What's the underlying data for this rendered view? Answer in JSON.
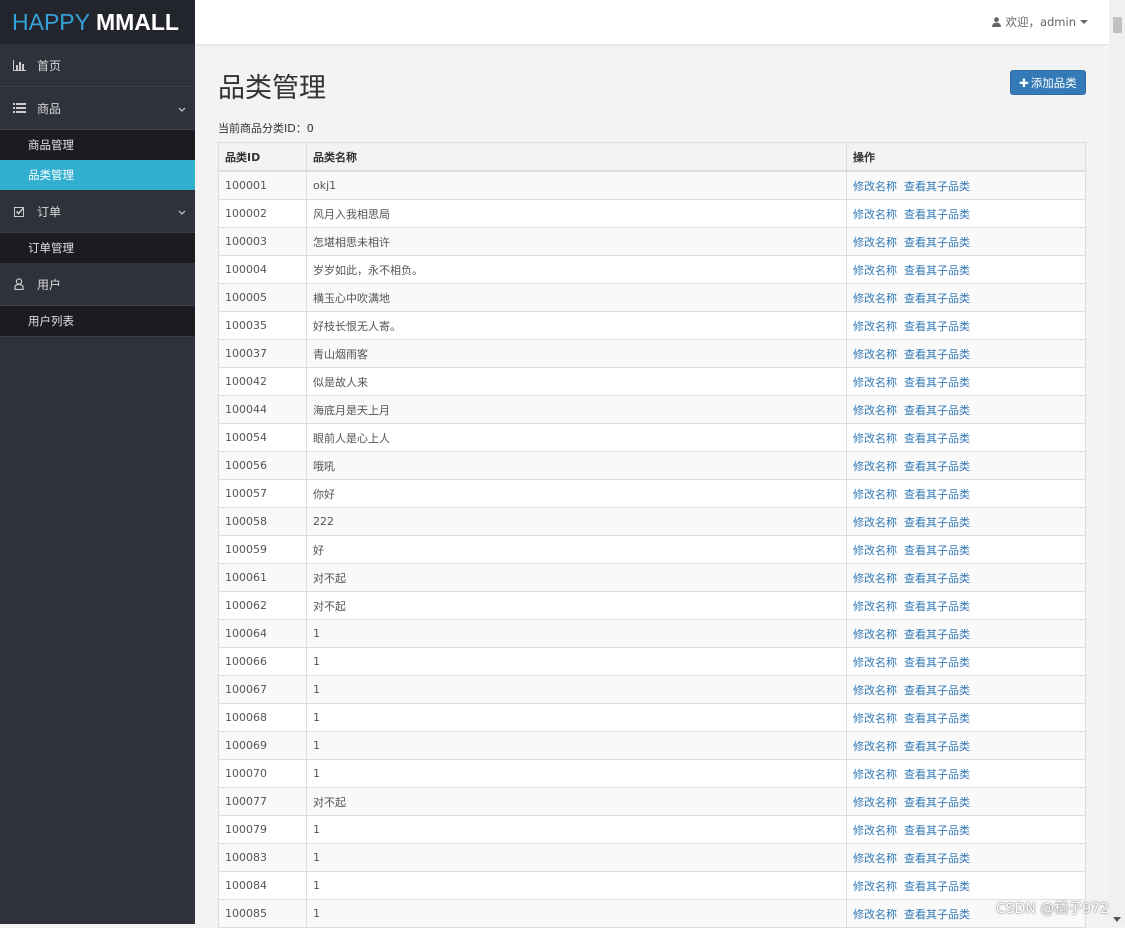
{
  "logo": {
    "part1": "HAPPY",
    "part2": "MMALL"
  },
  "sidebar": {
    "home": "首页",
    "product": "商品",
    "product_sub": [
      "商品管理",
      "品类管理"
    ],
    "order": "订单",
    "order_sub": [
      "订单管理"
    ],
    "user": "用户",
    "user_sub": [
      "用户列表"
    ]
  },
  "header": {
    "welcome": "欢迎，admin"
  },
  "page": {
    "title": "品类管理",
    "add_button": "添加品类",
    "current_id_label": "当前商品分类ID：0"
  },
  "table": {
    "headers": [
      "品类ID",
      "品类名称",
      "操作"
    ],
    "action_edit": "修改名称",
    "action_view": "查看其子品类",
    "rows": [
      {
        "id": "100001",
        "name": "okj1"
      },
      {
        "id": "100002",
        "name": "风月入我相思局"
      },
      {
        "id": "100003",
        "name": "怎堪相思未相许"
      },
      {
        "id": "100004",
        "name": "岁岁如此，永不相负。"
      },
      {
        "id": "100005",
        "name": "横玉心中吹满地"
      },
      {
        "id": "100035",
        "name": "好枝长恨无人寄。"
      },
      {
        "id": "100037",
        "name": "青山烟雨客"
      },
      {
        "id": "100042",
        "name": "似是故人来"
      },
      {
        "id": "100044",
        "name": "海底月是天上月"
      },
      {
        "id": "100054",
        "name": "眼前人是心上人"
      },
      {
        "id": "100056",
        "name": "哦吼"
      },
      {
        "id": "100057",
        "name": "你好"
      },
      {
        "id": "100058",
        "name": "222"
      },
      {
        "id": "100059",
        "name": "好"
      },
      {
        "id": "100061",
        "name": "对不起"
      },
      {
        "id": "100062",
        "name": "对不起"
      },
      {
        "id": "100064",
        "name": "1"
      },
      {
        "id": "100066",
        "name": "1"
      },
      {
        "id": "100067",
        "name": "1"
      },
      {
        "id": "100068",
        "name": "1"
      },
      {
        "id": "100069",
        "name": "1"
      },
      {
        "id": "100070",
        "name": "1"
      },
      {
        "id": "100077",
        "name": "对不起"
      },
      {
        "id": "100079",
        "name": "1"
      },
      {
        "id": "100083",
        "name": "1"
      },
      {
        "id": "100084",
        "name": "1"
      },
      {
        "id": "100085",
        "name": "1"
      }
    ]
  },
  "watermark": "CSDN @橘子972",
  "colors": {
    "accent": "#31afcf",
    "primary": "#337ab7",
    "sidebar": "#2f323b"
  }
}
